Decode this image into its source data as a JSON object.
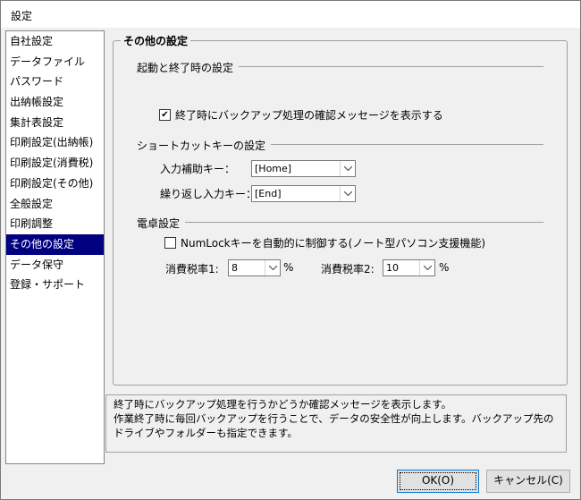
{
  "window": {
    "title": "設定"
  },
  "sidebar": {
    "items": [
      {
        "label": "自社設定"
      },
      {
        "label": "データファイル"
      },
      {
        "label": "パスワード"
      },
      {
        "label": "出納帳設定"
      },
      {
        "label": "集計表設定"
      },
      {
        "label": "印刷設定(出納帳)"
      },
      {
        "label": "印刷設定(消費税)"
      },
      {
        "label": "印刷設定(その他)"
      },
      {
        "label": "全般設定"
      },
      {
        "label": "印刷調整"
      },
      {
        "label": "その他の設定",
        "selected": true
      },
      {
        "label": "データ保守"
      },
      {
        "label": "登録・サポート"
      }
    ]
  },
  "panel": {
    "title": "その他の設定",
    "startup": {
      "title": "起動と終了時の設定",
      "backup_checkbox": {
        "label": "終了時にバックアップ処理の確認メッセージを表示する",
        "checked": true
      }
    },
    "shortcut": {
      "title": "ショートカットキーの設定",
      "input_assist_label": "入力補助キー：",
      "input_assist_value": "[Home]",
      "repeat_input_label": "繰り返し入力キー：",
      "repeat_input_value": "[End]"
    },
    "calculator": {
      "title": "電卓設定",
      "numlock_checkbox": {
        "label": "NumLockキーを自動的に制御する(ノート型パソコン支援機能)",
        "checked": false
      },
      "tax1_label": "消費税率1:",
      "tax1_value": "8",
      "tax1_unit": "%",
      "tax2_label": "消費税率2:",
      "tax2_value": "10",
      "tax2_unit": "%"
    }
  },
  "description": {
    "line1": "終了時にバックアップ処理を行うかどうか確認メッセージを表示します。",
    "line2": "作業終了時に毎回バックアップを行うことで、データの安全性が向上します。バックアップ先のドライブやフォルダーも指定できます。"
  },
  "buttons": {
    "ok": "OK(O)",
    "cancel": "キャンセル(C)"
  },
  "icons": {
    "check": "✔",
    "dropdown": "chevron-down-icon"
  }
}
